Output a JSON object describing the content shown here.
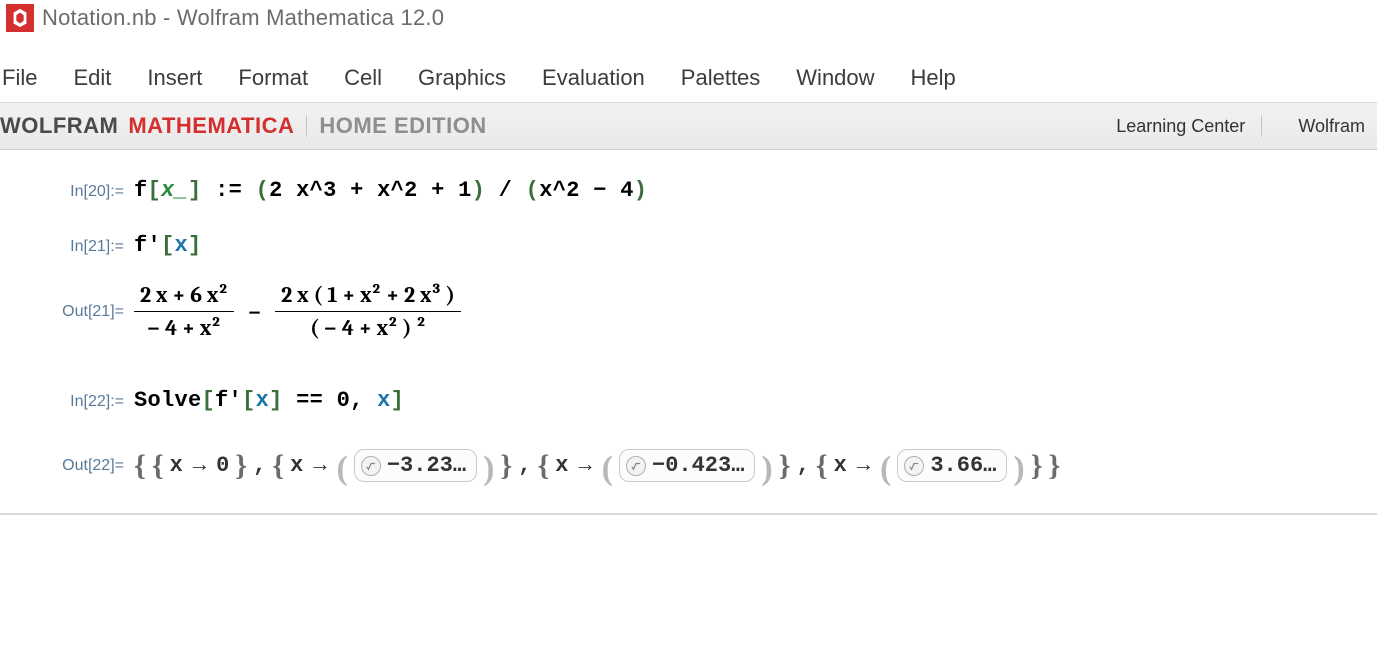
{
  "window": {
    "title": "Notation.nb - Wolfram Mathematica 12.0"
  },
  "menu": {
    "items": [
      "File",
      "Edit",
      "Insert",
      "Format",
      "Cell",
      "Graphics",
      "Evaluation",
      "Palettes",
      "Window",
      "Help"
    ]
  },
  "brand": {
    "wolfram": "WOLFRAM",
    "mathematica": "MATHEMATICA",
    "edition": "HOME EDITION",
    "links": [
      "Learning Center",
      "Wolfram"
    ]
  },
  "cells": {
    "in20": {
      "label": "In[20]:=",
      "funcName": "f",
      "pattern": "x_",
      "assign": " := ",
      "lparen": "(",
      "poly_a": "2 x^3 + x^2 + 1",
      "rparen": ")",
      "div": " / ",
      "lparen2": "(",
      "poly_b": "x^2 − 4",
      "rparen2": ")"
    },
    "in21": {
      "label": "In[21]:=",
      "funcPrime": "f'",
      "var": "x"
    },
    "out21": {
      "label": "Out[21]=",
      "frac1": {
        "num": "2 x + 6 x²",
        "den": "− 4 + x²"
      },
      "minus": "−",
      "frac2": {
        "num": "2 x ( 1 + x² + 2 x³ )",
        "den": "( − 4 + x² ) ²"
      }
    },
    "in22": {
      "label": "In[22]:=",
      "solve": "Solve",
      "fprime": "f'",
      "var": "x",
      "eq": " == ",
      "zero": "0",
      "comma": ", ",
      "var2": "x"
    },
    "out22": {
      "label": "Out[22]=",
      "rules": [
        {
          "var": "x",
          "arrow": "→",
          "value": "0",
          "approx": false
        },
        {
          "var": "x",
          "arrow": "→",
          "value": "−3.23…",
          "approx": true
        },
        {
          "var": "x",
          "arrow": "→",
          "value": "−0.423…",
          "approx": true
        },
        {
          "var": "x",
          "arrow": "→",
          "value": "3.66…",
          "approx": true
        }
      ]
    }
  }
}
